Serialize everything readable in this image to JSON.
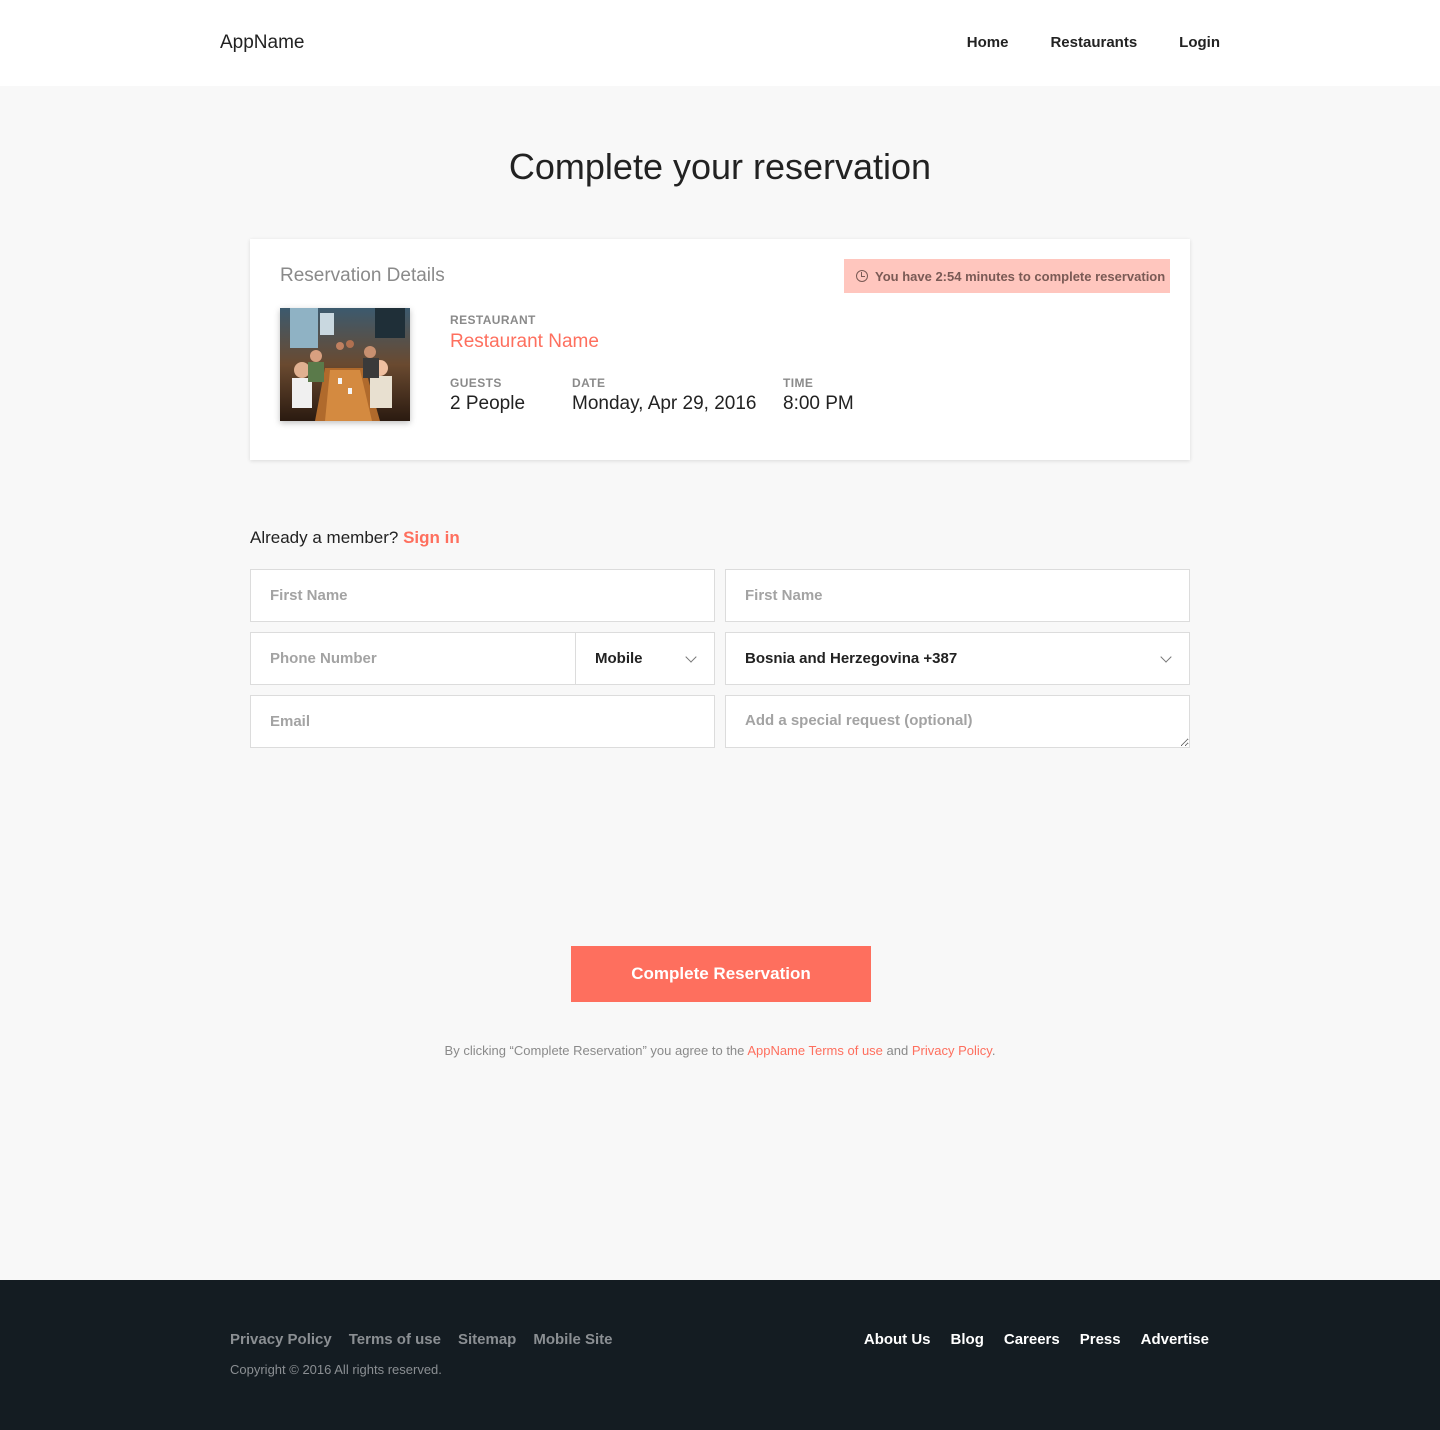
{
  "header": {
    "brand": "AppName",
    "nav": [
      "Home",
      "Restaurants",
      "Login"
    ]
  },
  "page_title": "Complete your reservation",
  "reservation": {
    "title": "Reservation Details",
    "timer_text": "You have 2:54 minutes to complete reservation",
    "restaurant_label": "RESTAURANT",
    "restaurant_name": "Restaurant Name",
    "guests_label": "GUESTS",
    "guests_value": "2 People",
    "date_label": "DATE",
    "date_value": "Monday, Apr 29, 2016",
    "time_label": "TIME",
    "time_value": "8:00 PM"
  },
  "member": {
    "text": "Already a member?",
    "signin": "Sign in"
  },
  "form": {
    "first_name_placeholder": "First Name",
    "last_name_placeholder": "First Name",
    "phone_placeholder": "Phone Number",
    "phone_type": "Mobile",
    "country": "Bosnia and Herzegovina +387",
    "email_placeholder": "Email",
    "request_placeholder": "Add a special request (optional)"
  },
  "submit_label": "Complete Reservation",
  "terms": {
    "prefix": "By clicking “Complete Reservation” you agree to the",
    "terms_link": "AppName Terms of use",
    "and": "and",
    "privacy_link": "Privacy Policy",
    "suffix": "."
  },
  "footer": {
    "left_links": [
      "Privacy Policy",
      "Terms of use",
      "Sitemap",
      "Mobile Site"
    ],
    "copyright": "Copyright © 2016 All rights reserved.",
    "right_links": [
      "About Us",
      "Blog",
      "Careers",
      "Press",
      "Advertise"
    ]
  },
  "colors": {
    "accent": "#fe6f5e",
    "timer_bg": "#ffc6be",
    "footer_bg": "#141c22",
    "page_bg": "#f8f8f8"
  }
}
